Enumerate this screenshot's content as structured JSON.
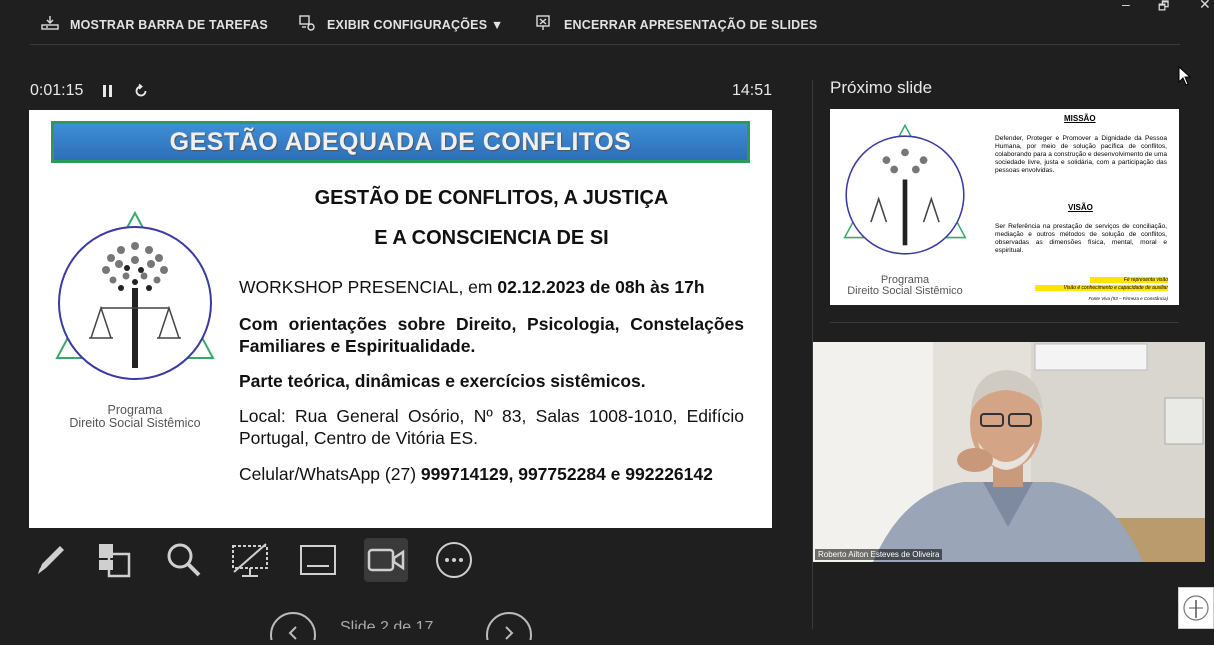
{
  "toolbar": {
    "taskbar_label": "MOSTRAR BARRA DE TAREFAS",
    "settings_label": "EXIBIR CONFIGURAÇÕES ▼",
    "end_label": "ENCERRAR APRESENTAÇÃO DE SLIDES"
  },
  "window": {
    "minimize": "–",
    "restore": "🗗",
    "close": "✕"
  },
  "timer": {
    "elapsed": "0:01:15",
    "clock": "14:51"
  },
  "slide": {
    "banner": "GESTÃO ADEQUADA DE CONFLITOS",
    "heading_line1": "GESTÃO DE CONFLITOS, A JUSTIÇA",
    "heading_line2": "E A CONSCIENCIA DE SI",
    "workshop_prefix": "WORKSHOP PRESENCIAL, em ",
    "workshop_date": "02.12.2023 de 08h às 17h",
    "orientations": "Com orientações sobre Direito, Psicologia, Constelações Familiares e Espiritualidade.",
    "theory": "Parte teórica, dinâmicas e exercícios sistêmicos.",
    "location": "Local: Rua General Osório, Nº 83, Salas 1008-1010, Edifício Portugal, Centro de Vitória ES.",
    "phone_prefix": "Celular/WhatsApp (27) ",
    "phone_numbers": "999714129, 997752284 e 992226142",
    "logo_line1": "Programa",
    "logo_line2": "Direito Social Sistêmico"
  },
  "next": {
    "label": "Próximo slide",
    "mission_title": "MISSÃO",
    "mission_text": "Defender, Proteger e Promover a Dignidade da Pessoa Humana, por meio de solução pacífica de conflitos, colaborando para a construção e desenvolvimento de uma sociedade livre, justa e solidária, com a participação das pessoas envolvidas.",
    "vision_title": "VISÃO",
    "vision_text": "Ser Referência na prestação de serviços de conciliação, mediação e outros métodos de solução de conflitos, observadas as dimensões física, mental, moral e espiritual.",
    "faith_note": "Fé representa visão",
    "vision_note": "Visão é conhecimento e capacidade de auxiliar",
    "source_note": "Fonte Viva (93 – Firmeza e Constância)",
    "logo_line1": "Programa",
    "logo_line2": "Direito Social Sistêmico"
  },
  "video": {
    "participant_name": "Roberto Ailton Esteves de Oliveira"
  },
  "nav": {
    "slide_counter": "Slide 2 de 17"
  },
  "icons": [
    "taskbar-icon",
    "settings-icon",
    "end-show-icon",
    "pause-icon",
    "reset-icon",
    "pen-icon",
    "all-slides-icon",
    "zoom-icon",
    "black-screen-icon",
    "subtitles-icon",
    "camera-icon",
    "more-options-icon"
  ],
  "colors": {
    "background": "#1f1f1f",
    "banner": "#2f7fcb",
    "banner_border": "#2f9a57",
    "active_tool": "#3a3a3a"
  }
}
